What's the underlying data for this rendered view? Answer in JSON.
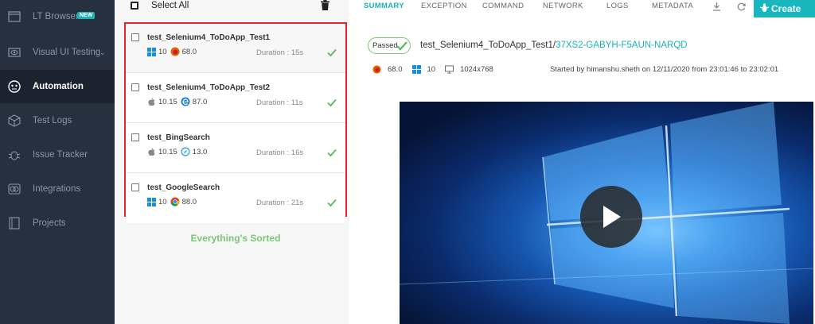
{
  "sidebar": {
    "items": [
      {
        "label": "LT Browser",
        "badge": "NEW",
        "icon": "browser-icon"
      },
      {
        "label": "Visual UI Testing",
        "icon": "eye-icon"
      },
      {
        "label": "Automation",
        "icon": "robot-icon"
      },
      {
        "label": "Test Logs",
        "icon": "cube-icon"
      },
      {
        "label": "Issue Tracker",
        "icon": "bug-icon"
      },
      {
        "label": "Integrations",
        "icon": "integrations-icon"
      },
      {
        "label": "Projects",
        "icon": "folder-icon"
      }
    ]
  },
  "list": {
    "select_all": "Select All",
    "tests": [
      {
        "name": "test_Selenium4_ToDoApp_Test1",
        "os_version": "10",
        "browser_version": "68.0",
        "duration": "Duration : 15s"
      },
      {
        "name": "test_Selenium4_ToDoApp_Test2",
        "os_version": "10.15",
        "browser_version": "87.0",
        "duration": "Duration : 11s"
      },
      {
        "name": "test_BingSearch",
        "os_version": "10.15",
        "browser_version": "13.0",
        "duration": "Duration : 16s"
      },
      {
        "name": "test_GoogleSearch",
        "os_version": "10",
        "browser_version": "88.0",
        "duration": "Duration : 21s"
      }
    ],
    "footer": "Everything's Sorted"
  },
  "tabs": [
    "SUMMARY",
    "EXCEPTION",
    "COMMAND",
    "NETWORK",
    "LOGS",
    "METADATA"
  ],
  "create_label": "Create",
  "detail": {
    "status": "Passed",
    "test_name": "test_Selenium4_ToDoApp_Test1/",
    "test_id": "37XS2-GABYH-F5AUN-NARQD",
    "browser_version": "68.0",
    "os_version": "10",
    "resolution": "1024x768",
    "started": "Started by himanshu.sheth on 12/11/2020 from 23:01:46 to 23:02:01"
  },
  "colors": {
    "accent": "#1ab2b8",
    "sidebar": "#27303f",
    "pass": "#5cb85c",
    "highlight": "#e0282e"
  }
}
